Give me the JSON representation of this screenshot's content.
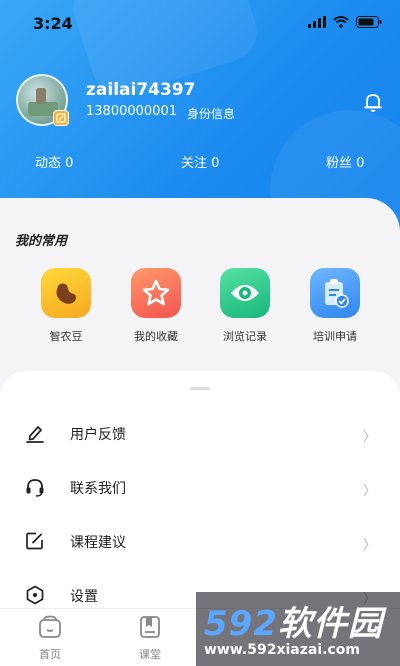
{
  "status_bar": {
    "time": "3:24"
  },
  "profile": {
    "username": "zailai74397",
    "phone": "13800000001",
    "id_info_link": "身份信息"
  },
  "stats": [
    {
      "label": "动态 0"
    },
    {
      "label": "关注 0"
    },
    {
      "label": "粉丝 0"
    }
  ],
  "common": {
    "title": "我的常用",
    "items": [
      {
        "label": "智农豆",
        "icon": "bean-icon"
      },
      {
        "label": "我的收藏",
        "icon": "star-icon"
      },
      {
        "label": "浏览记录",
        "icon": "eye-icon"
      },
      {
        "label": "培训申请",
        "icon": "clipboard-check-icon"
      }
    ]
  },
  "menu": [
    {
      "label": "用户反馈",
      "icon": "pencil-icon"
    },
    {
      "label": "联系我们",
      "icon": "headset-icon"
    },
    {
      "label": "课程建议",
      "icon": "edit-square-icon"
    },
    {
      "label": "设置",
      "icon": "settings-hexagon-icon"
    }
  ],
  "tabbar": [
    {
      "label": "首页",
      "icon": "home-icon"
    },
    {
      "label": "课堂",
      "icon": "classroom-icon"
    }
  ],
  "watermark": {
    "logo_num": "592",
    "logo_text": "软件园",
    "url": "www.592xiazai.com"
  },
  "colors": {
    "primary": "#1c8cf0",
    "bean": "#f6a820",
    "fav": "#f2544f",
    "eye": "#17b87a",
    "apply": "#2f86ee"
  }
}
